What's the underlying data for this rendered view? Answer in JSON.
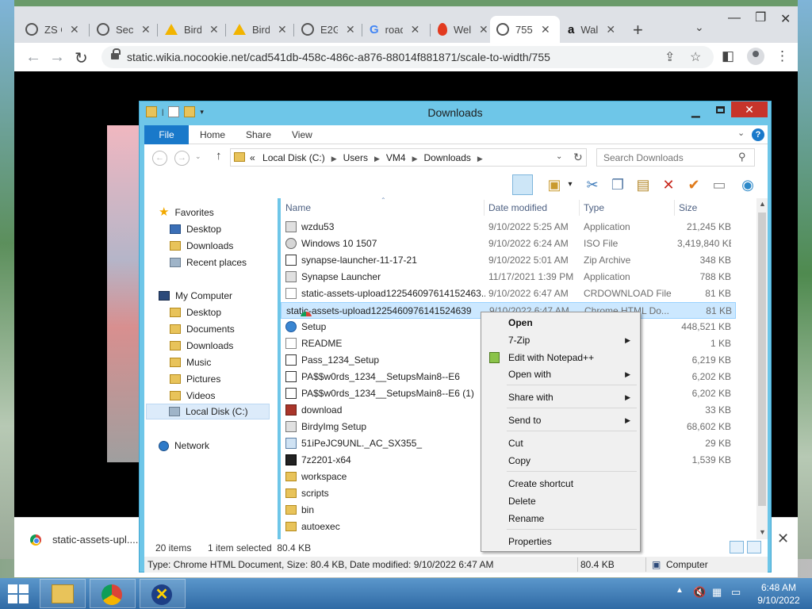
{
  "browser": {
    "tabs": [
      {
        "label": "ZS C",
        "icon": "globe-icon"
      },
      {
        "label": "Secu",
        "icon": "globe-icon"
      },
      {
        "label": "Birds",
        "icon": "drive-icon"
      },
      {
        "label": "Birds",
        "icon": "drive-icon"
      },
      {
        "label": "E2G",
        "icon": "globe-icon"
      },
      {
        "label": "road",
        "icon": "google-icon"
      },
      {
        "label": "Wel",
        "icon": "fire-icon"
      },
      {
        "label": "755",
        "icon": "globe-icon",
        "active": true
      },
      {
        "label": "Wal",
        "icon": "amazon-icon"
      }
    ],
    "url": "static.wikia.nocookie.net/cad541db-458c-486c-a876-88014f881871/scale-to-width/755",
    "download_bar": {
      "file": "static-assets-upl....htm"
    }
  },
  "explorer": {
    "title": "Downloads",
    "ribbon_tabs": [
      "File",
      "Home",
      "Share",
      "View"
    ],
    "breadcrumb": [
      "Local Disk (C:)",
      "Users",
      "VM4",
      "Downloads"
    ],
    "breadcrumb_prefix": "«",
    "search_placeholder": "Search Downloads",
    "columns": {
      "name": "Name",
      "date": "Date modified",
      "type": "Type",
      "size": "Size"
    },
    "nav": {
      "favorites": "Favorites",
      "fav_items": [
        "Desktop",
        "Downloads",
        "Recent places"
      ],
      "computer": "My Computer",
      "computer_items": [
        "Desktop",
        "Documents",
        "Downloads",
        "Music",
        "Pictures",
        "Videos",
        "Local Disk (C:)"
      ],
      "network": "Network"
    },
    "files": [
      {
        "name": "wzdu53",
        "date": "9/10/2022 5:25 AM",
        "type": "Application",
        "size": "21,245 KB",
        "icon": "app"
      },
      {
        "name": "Windows 10 1507",
        "date": "9/10/2022 6:24 AM",
        "type": "ISO File",
        "size": "3,419,840 KB",
        "icon": "iso"
      },
      {
        "name": "synapse-launcher-11-17-21",
        "date": "9/10/2022 5:01 AM",
        "type": "Zip Archive",
        "size": "348 KB",
        "icon": "zip"
      },
      {
        "name": "Synapse Launcher",
        "date": "11/17/2021 1:39 PM",
        "type": "Application",
        "size": "788 KB",
        "icon": "app"
      },
      {
        "name": "static-assets-upload122546097614152463...",
        "date": "9/10/2022 6:47 AM",
        "type": "CRDOWNLOAD File",
        "size": "81 KB",
        "icon": "doc"
      },
      {
        "name": "static-assets-upload1225460976141524639",
        "date": "9/10/2022 6:47 AM",
        "type": "Chrome HTML Do...",
        "size": "81 KB",
        "icon": "chrome",
        "selected": true
      },
      {
        "name": "Setup",
        "date": "",
        "type": "",
        "size": "448,521 KB",
        "icon": "setup"
      },
      {
        "name": "README",
        "date": "",
        "type": "ent",
        "size": "1 KB",
        "icon": "doc"
      },
      {
        "name": "Pass_1234_Setup",
        "date": "",
        "type": "",
        "size": "6,219 KB",
        "icon": "zip"
      },
      {
        "name": "PA$$w0rds_1234__SetupsMain8--E6",
        "date": "",
        "type": "",
        "size": "6,202 KB",
        "icon": "zip"
      },
      {
        "name": "PA$$w0rds_1234__SetupsMain8--E6 (1)",
        "date": "",
        "type": "",
        "size": "6,202 KB",
        "icon": "zip"
      },
      {
        "name": "download",
        "date": "",
        "type": "",
        "size": "33 KB",
        "icon": "dl"
      },
      {
        "name": "BirdyImg Setup",
        "date": "",
        "type": "",
        "size": "68,602 KB",
        "icon": "app"
      },
      {
        "name": "51iPeJC9UNL._AC_SX355_",
        "date": "",
        "type": "",
        "size": "29 KB",
        "icon": "img"
      },
      {
        "name": "7z2201-x64",
        "date": "",
        "type": "",
        "size": "1,539 KB",
        "icon": "z7"
      },
      {
        "name": "workspace",
        "date": "",
        "type": "",
        "size": "",
        "icon": "folder"
      },
      {
        "name": "scripts",
        "date": "",
        "type": "",
        "size": "",
        "icon": "folder"
      },
      {
        "name": "bin",
        "date": "",
        "type": "",
        "size": "",
        "icon": "folder"
      },
      {
        "name": "autoexec",
        "date": "",
        "type": "",
        "size": "",
        "icon": "folder"
      }
    ],
    "item_count": "20 items",
    "selected_count": "1 item selected  80.4 KB",
    "status_text": "Type: Chrome HTML Document, Size: 80.4 KB, Date modified: 9/10/2022 6:47 AM",
    "status_size": "80.4 KB",
    "status_location": "Computer"
  },
  "context_menu": {
    "items": [
      {
        "label": "Open",
        "bold": true
      },
      {
        "label": "7-Zip",
        "submenu": true
      },
      {
        "label": "Edit with Notepad++",
        "icon": "notepadpp-icon"
      },
      {
        "label": "Open with",
        "submenu": true
      },
      {
        "label": "Share with",
        "submenu": true
      },
      {
        "label": "Send to",
        "submenu": true
      },
      {
        "label": "Cut"
      },
      {
        "label": "Copy"
      },
      {
        "label": "Create shortcut"
      },
      {
        "label": "Delete"
      },
      {
        "label": "Rename"
      },
      {
        "label": "Properties"
      }
    ]
  },
  "taskbar": {
    "time": "6:48 AM",
    "date": "9/10/2022"
  }
}
